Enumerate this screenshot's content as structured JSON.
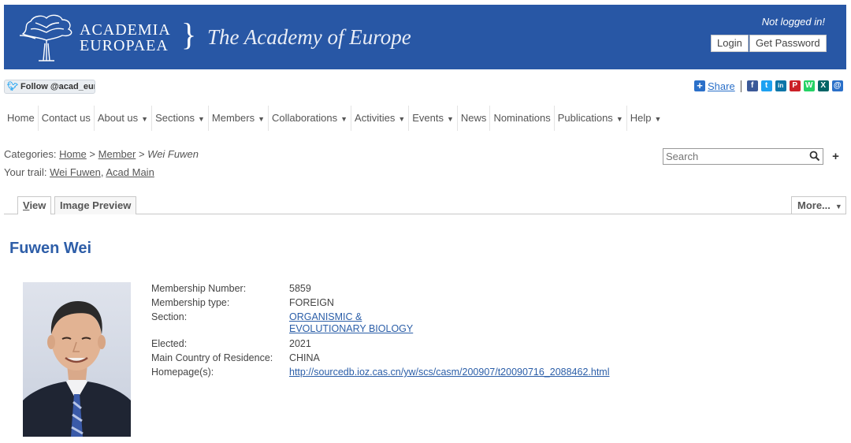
{
  "header": {
    "logo_line1": "ACADEMIA",
    "logo_line2": "EUROPAEA",
    "tagline": "The Academy of Europe",
    "login_status": "Not logged in!",
    "login_label": "Login",
    "get_password_label": "Get Password"
  },
  "social": {
    "follow_label": "Follow @acad_euro",
    "share_label": "Share",
    "icons": [
      {
        "name": "facebook-icon",
        "glyph": "f",
        "color": "#3b5998"
      },
      {
        "name": "twitter-icon",
        "glyph": "t",
        "color": "#1da1f2"
      },
      {
        "name": "linkedin-icon",
        "glyph": "in",
        "color": "#0e76a8"
      },
      {
        "name": "pinterest-icon",
        "glyph": "P",
        "color": "#cb2027"
      },
      {
        "name": "whatsapp-icon",
        "glyph": "W",
        "color": "#25d366"
      },
      {
        "name": "xing-icon",
        "glyph": "X",
        "color": "#026466"
      },
      {
        "name": "email-icon",
        "glyph": "@",
        "color": "#2b70c9"
      }
    ]
  },
  "nav": {
    "items": [
      {
        "label": "Home",
        "dropdown": false
      },
      {
        "label": "Contact us",
        "dropdown": false
      },
      {
        "label": "About us",
        "dropdown": true
      },
      {
        "label": "Sections",
        "dropdown": true
      },
      {
        "label": "Members",
        "dropdown": true
      },
      {
        "label": "Collaborations",
        "dropdown": true
      },
      {
        "label": "Activities",
        "dropdown": true
      },
      {
        "label": "Events",
        "dropdown": true
      },
      {
        "label": "News",
        "dropdown": false
      },
      {
        "label": "Nominations",
        "dropdown": false
      },
      {
        "label": "Publications",
        "dropdown": true
      },
      {
        "label": "Help",
        "dropdown": true
      }
    ]
  },
  "breadcrumb": {
    "prefix": "Categories:",
    "home": "Home",
    "member": "Member",
    "current": "Wei Fuwen",
    "sep": ">"
  },
  "trail": {
    "prefix": "Your trail:",
    "link1": "Wei Fuwen",
    "link2": "Acad Main"
  },
  "search": {
    "placeholder": "Search"
  },
  "tabs": {
    "view_first": "V",
    "view_rest": "iew",
    "image_preview": "Image Preview",
    "more": "More..."
  },
  "member": {
    "name": "Fuwen Wei",
    "fields": {
      "membership_number_label": "Membership Number:",
      "membership_number": "5859",
      "membership_type_label": "Membership type:",
      "membership_type": "FOREIGN",
      "section_label": "Section:",
      "section_line1": "ORGANISMIC &",
      "section_line2": "EVOLUTIONARY BIOLOGY",
      "elected_label": "Elected:",
      "elected": "2021",
      "country_label": "Main Country of Residence:",
      "country": "CHINA",
      "homepage_label": "Homepage(s):",
      "homepage": "http://sourcedb.ioz.cas.cn/yw/scs/casm/200907/t20090716_2088462.html"
    }
  }
}
